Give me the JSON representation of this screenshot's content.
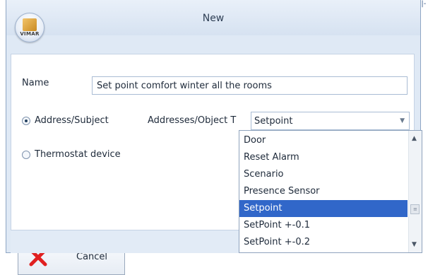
{
  "background": {
    "corner_mark": "+|-("
  },
  "window": {
    "title": "New",
    "logo_text": "VIMAR"
  },
  "form": {
    "name_label": "Name",
    "name_value": "Set point comfort winter all the rooms",
    "radio_address": "Address/Subject",
    "radio_thermostat": "Thermostat device",
    "address_type_label": "Addresses/Object T",
    "address_type_value": "Setpoint"
  },
  "dropdown": {
    "options": [
      "Door",
      "Reset Alarm",
      "Scenario",
      "Presence Sensor",
      "Setpoint",
      "SetPoint +-0.1",
      "SetPoint +-0.2"
    ],
    "selected": "Setpoint"
  },
  "cancel_label": "Cancel",
  "colors": {
    "selection": "#3167c9",
    "cancel_icon": "#e02020"
  },
  "icons": {
    "close": "close-x-icon",
    "chevron": "chevron-down-icon",
    "scroll_up": "scroll-up-icon",
    "scroll_down": "scroll-down-icon"
  }
}
